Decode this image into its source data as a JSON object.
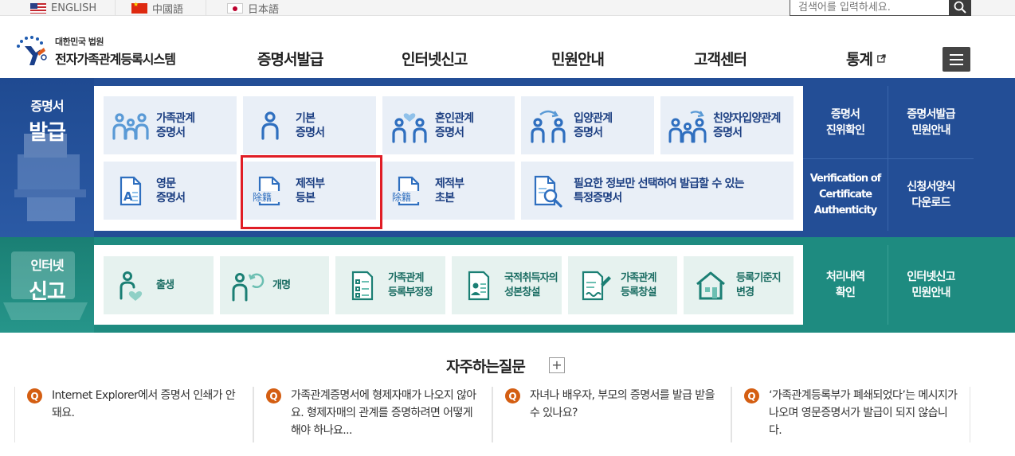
{
  "languages": [
    "ENGLISH",
    "中國語",
    "日本語"
  ],
  "search": {
    "placeholder": "검색어를 입력하세요."
  },
  "logo": {
    "small": "대한민국 법원",
    "big": "전자가족관계등록시스템"
  },
  "nav": [
    "증명서발급",
    "인터넷신고",
    "민원안내",
    "고객센터",
    "통계"
  ],
  "certificate": {
    "label_top": "증명서",
    "label_bottom": "발급",
    "row1": [
      {
        "l1": "가족관계",
        "l2": "증명서"
      },
      {
        "l1": "기본",
        "l2": "증명서"
      },
      {
        "l1": "혼인관계",
        "l2": "증명서"
      },
      {
        "l1": "입양관계",
        "l2": "증명서"
      },
      {
        "l1": "친양자입양관계",
        "l2": "증명서"
      }
    ],
    "row2": [
      {
        "l1": "영문",
        "l2": "증명서"
      },
      {
        "l1": "제적부",
        "l2": "등본"
      },
      {
        "l1": "제적부",
        "l2": "초본"
      },
      {
        "l1": "필요한 정보만 선택하여 발급할 수 있는",
        "l2": "특정증명서"
      }
    ],
    "icon_hanja": "除籍",
    "side": [
      {
        "l1": "증명서",
        "l2": "진위확인"
      },
      {
        "l1": "증명서발급",
        "l2": "민원안내"
      },
      {
        "l1": "Verification of",
        "l2": "Certificate",
        "l3": "Authenticity"
      },
      {
        "l1": "신청서양식",
        "l2": "다운로드"
      }
    ]
  },
  "report": {
    "label_top": "인터넷",
    "label_bottom": "신고",
    "tiles": [
      {
        "l1": "출생",
        "l2": ""
      },
      {
        "l1": "개명",
        "l2": ""
      },
      {
        "l1": "가족관계",
        "l2": "등록부정정"
      },
      {
        "l1": "국적취득자의",
        "l2": "성본창설"
      },
      {
        "l1": "가족관계",
        "l2": "등록창설"
      },
      {
        "l1": "등록기준지",
        "l2": "변경"
      }
    ],
    "side": [
      {
        "l1": "처리내역",
        "l2": "확인"
      },
      {
        "l1": "인터넷신고",
        "l2": "민원안내"
      }
    ]
  },
  "faq": {
    "title": "자주하는질문",
    "plus": "+",
    "q_badge": "Q",
    "items": [
      "Internet Explorer에서 증명서 인쇄가 안돼요.",
      "가족관계증명서에 형제자매가 나오지 않아요. 형제자매의 관계를 증명하려면 어떻게 해야 하나요...",
      "자녀나 배우자, 부모의 증명서를 발급 받을 수 있나요?",
      "‘가족관계등록부가 폐쇄되었다’는 메시지가 나오며 영문증명서가 발급이 되지 않습니다."
    ]
  },
  "colors": {
    "blue_band": "#234e96",
    "teal_band": "#1e8b80",
    "tile_text_blue": "#1c3f82",
    "highlight": "#e01d25",
    "faq_badge": "#d45e12"
  }
}
